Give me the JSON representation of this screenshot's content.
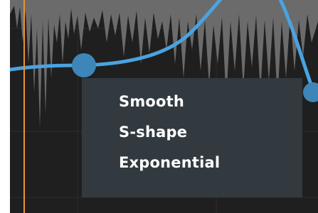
{
  "context_menu": {
    "items": [
      {
        "label": "Smooth"
      },
      {
        "label": "S-shape"
      },
      {
        "label": "Exponential"
      }
    ]
  },
  "colors": {
    "background": "#1f1f1f",
    "waveform": "#6a6a6a",
    "curve": "#4aa3e0",
    "playhead": "#e8913a",
    "menu_background": "#323a3f",
    "menu_text": "#ffffff"
  }
}
